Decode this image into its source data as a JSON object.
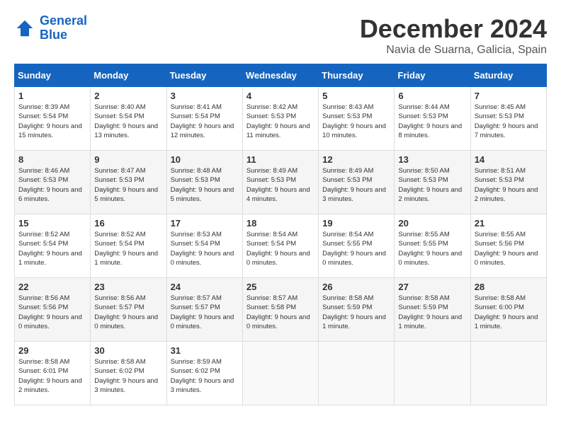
{
  "logo": {
    "line1": "General",
    "line2": "Blue"
  },
  "title": "December 2024",
  "subtitle": "Navia de Suarna, Galicia, Spain",
  "headers": [
    "Sunday",
    "Monday",
    "Tuesday",
    "Wednesday",
    "Thursday",
    "Friday",
    "Saturday"
  ],
  "weeks": [
    [
      {
        "day": "1",
        "sunrise": "Sunrise: 8:39 AM",
        "sunset": "Sunset: 5:54 PM",
        "daylight": "Daylight: 9 hours and 15 minutes."
      },
      {
        "day": "2",
        "sunrise": "Sunrise: 8:40 AM",
        "sunset": "Sunset: 5:54 PM",
        "daylight": "Daylight: 9 hours and 13 minutes."
      },
      {
        "day": "3",
        "sunrise": "Sunrise: 8:41 AM",
        "sunset": "Sunset: 5:54 PM",
        "daylight": "Daylight: 9 hours and 12 minutes."
      },
      {
        "day": "4",
        "sunrise": "Sunrise: 8:42 AM",
        "sunset": "Sunset: 5:53 PM",
        "daylight": "Daylight: 9 hours and 11 minutes."
      },
      {
        "day": "5",
        "sunrise": "Sunrise: 8:43 AM",
        "sunset": "Sunset: 5:53 PM",
        "daylight": "Daylight: 9 hours and 10 minutes."
      },
      {
        "day": "6",
        "sunrise": "Sunrise: 8:44 AM",
        "sunset": "Sunset: 5:53 PM",
        "daylight": "Daylight: 9 hours and 8 minutes."
      },
      {
        "day": "7",
        "sunrise": "Sunrise: 8:45 AM",
        "sunset": "Sunset: 5:53 PM",
        "daylight": "Daylight: 9 hours and 7 minutes."
      }
    ],
    [
      {
        "day": "8",
        "sunrise": "Sunrise: 8:46 AM",
        "sunset": "Sunset: 5:53 PM",
        "daylight": "Daylight: 9 hours and 6 minutes."
      },
      {
        "day": "9",
        "sunrise": "Sunrise: 8:47 AM",
        "sunset": "Sunset: 5:53 PM",
        "daylight": "Daylight: 9 hours and 5 minutes."
      },
      {
        "day": "10",
        "sunrise": "Sunrise: 8:48 AM",
        "sunset": "Sunset: 5:53 PM",
        "daylight": "Daylight: 9 hours and 5 minutes."
      },
      {
        "day": "11",
        "sunrise": "Sunrise: 8:49 AM",
        "sunset": "Sunset: 5:53 PM",
        "daylight": "Daylight: 9 hours and 4 minutes."
      },
      {
        "day": "12",
        "sunrise": "Sunrise: 8:49 AM",
        "sunset": "Sunset: 5:53 PM",
        "daylight": "Daylight: 9 hours and 3 minutes."
      },
      {
        "day": "13",
        "sunrise": "Sunrise: 8:50 AM",
        "sunset": "Sunset: 5:53 PM",
        "daylight": "Daylight: 9 hours and 2 minutes."
      },
      {
        "day": "14",
        "sunrise": "Sunrise: 8:51 AM",
        "sunset": "Sunset: 5:53 PM",
        "daylight": "Daylight: 9 hours and 2 minutes."
      }
    ],
    [
      {
        "day": "15",
        "sunrise": "Sunrise: 8:52 AM",
        "sunset": "Sunset: 5:54 PM",
        "daylight": "Daylight: 9 hours and 1 minute."
      },
      {
        "day": "16",
        "sunrise": "Sunrise: 8:52 AM",
        "sunset": "Sunset: 5:54 PM",
        "daylight": "Daylight: 9 hours and 1 minute."
      },
      {
        "day": "17",
        "sunrise": "Sunrise: 8:53 AM",
        "sunset": "Sunset: 5:54 PM",
        "daylight": "Daylight: 9 hours and 0 minutes."
      },
      {
        "day": "18",
        "sunrise": "Sunrise: 8:54 AM",
        "sunset": "Sunset: 5:54 PM",
        "daylight": "Daylight: 9 hours and 0 minutes."
      },
      {
        "day": "19",
        "sunrise": "Sunrise: 8:54 AM",
        "sunset": "Sunset: 5:55 PM",
        "daylight": "Daylight: 9 hours and 0 minutes."
      },
      {
        "day": "20",
        "sunrise": "Sunrise: 8:55 AM",
        "sunset": "Sunset: 5:55 PM",
        "daylight": "Daylight: 9 hours and 0 minutes."
      },
      {
        "day": "21",
        "sunrise": "Sunrise: 8:55 AM",
        "sunset": "Sunset: 5:56 PM",
        "daylight": "Daylight: 9 hours and 0 minutes."
      }
    ],
    [
      {
        "day": "22",
        "sunrise": "Sunrise: 8:56 AM",
        "sunset": "Sunset: 5:56 PM",
        "daylight": "Daylight: 9 hours and 0 minutes."
      },
      {
        "day": "23",
        "sunrise": "Sunrise: 8:56 AM",
        "sunset": "Sunset: 5:57 PM",
        "daylight": "Daylight: 9 hours and 0 minutes."
      },
      {
        "day": "24",
        "sunrise": "Sunrise: 8:57 AM",
        "sunset": "Sunset: 5:57 PM",
        "daylight": "Daylight: 9 hours and 0 minutes."
      },
      {
        "day": "25",
        "sunrise": "Sunrise: 8:57 AM",
        "sunset": "Sunset: 5:58 PM",
        "daylight": "Daylight: 9 hours and 0 minutes."
      },
      {
        "day": "26",
        "sunrise": "Sunrise: 8:58 AM",
        "sunset": "Sunset: 5:59 PM",
        "daylight": "Daylight: 9 hours and 1 minute."
      },
      {
        "day": "27",
        "sunrise": "Sunrise: 8:58 AM",
        "sunset": "Sunset: 5:59 PM",
        "daylight": "Daylight: 9 hours and 1 minute."
      },
      {
        "day": "28",
        "sunrise": "Sunrise: 8:58 AM",
        "sunset": "Sunset: 6:00 PM",
        "daylight": "Daylight: 9 hours and 1 minute."
      }
    ],
    [
      {
        "day": "29",
        "sunrise": "Sunrise: 8:58 AM",
        "sunset": "Sunset: 6:01 PM",
        "daylight": "Daylight: 9 hours and 2 minutes."
      },
      {
        "day": "30",
        "sunrise": "Sunrise: 8:58 AM",
        "sunset": "Sunset: 6:02 PM",
        "daylight": "Daylight: 9 hours and 3 minutes."
      },
      {
        "day": "31",
        "sunrise": "Sunrise: 8:59 AM",
        "sunset": "Sunset: 6:02 PM",
        "daylight": "Daylight: 9 hours and 3 minutes."
      },
      null,
      null,
      null,
      null
    ]
  ]
}
